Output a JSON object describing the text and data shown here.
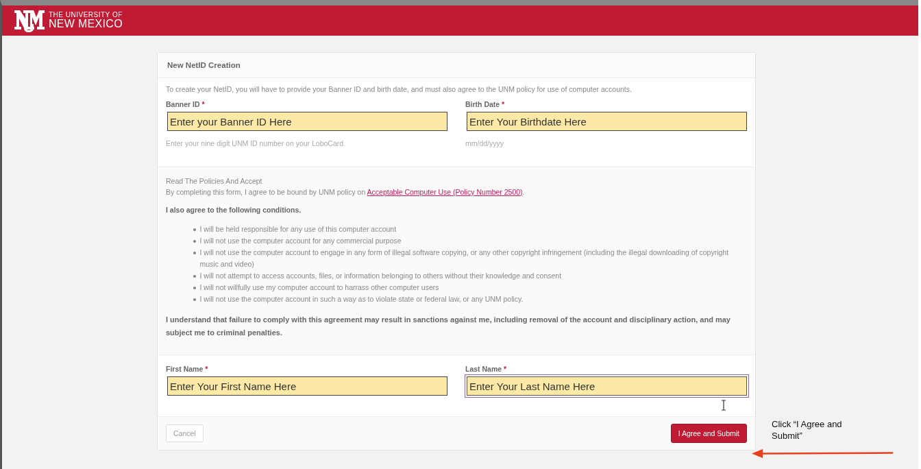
{
  "header": {
    "logo_line_1": "THE UNIVERSITY OF",
    "logo_line_2": "NEW MEXICO"
  },
  "card": {
    "title": "New NetID Creation",
    "intro": "To create your NetID, you will have to provide your Banner ID and birth date, and must also agree to the UNM policy for use of computer accounts.",
    "id_fields": [
      {
        "label": "Banner ID",
        "required_mark": "*",
        "value": "Enter your Banner ID Here",
        "help": "Enter your nine digit UNM ID number on your LoboCard."
      },
      {
        "label": "Birth Date",
        "required_mark": "*",
        "value": "Enter Your Birthdate Here",
        "help": "mm/dd/yyyy"
      }
    ],
    "policy_heading": "Read The Policies And Accept",
    "policy_text": "By completing this form, I agree to be bound by UNM policy on",
    "policy_link": "Acceptable Computer Use (Policy Number 2500)",
    "policy_end": ".",
    "conditions_heading": "I also agree to the following conditions.",
    "conditions": [
      "I will be held responsible for any use of this computer account",
      "I will not use the computer account for any commercial purpose",
      "I will not use the computer account to engage in any form of illegal software copying, or any other copyright infringement (including the illegal downloading of copyright music and video)",
      "I will not attempt to access accounts, files, or information belonging to others without their knowledge and consent",
      "I will not willfully use my computer account to harrass other computer users",
      "I will not use the computer account in such a way as to violate state or federal law, or any UNM policy."
    ],
    "agreement": "I understand that failure to comply with this agreement may result in sanctions against me, including removal of the account and disciplinary action, and may subject me to criminal penalties.",
    "name_fields": [
      {
        "label": "First Name",
        "required_mark": "*",
        "value": "Enter Your First Name Here",
        "focused": false
      },
      {
        "label": "Last Name",
        "required_mark": "*",
        "value": "Enter Your Last Name Here",
        "focused": true
      }
    ],
    "cancel_button": "Cancel",
    "submit_button": "I Agree and Submit"
  },
  "annotation": {
    "text": "Click “I Agree and Submit”"
  }
}
